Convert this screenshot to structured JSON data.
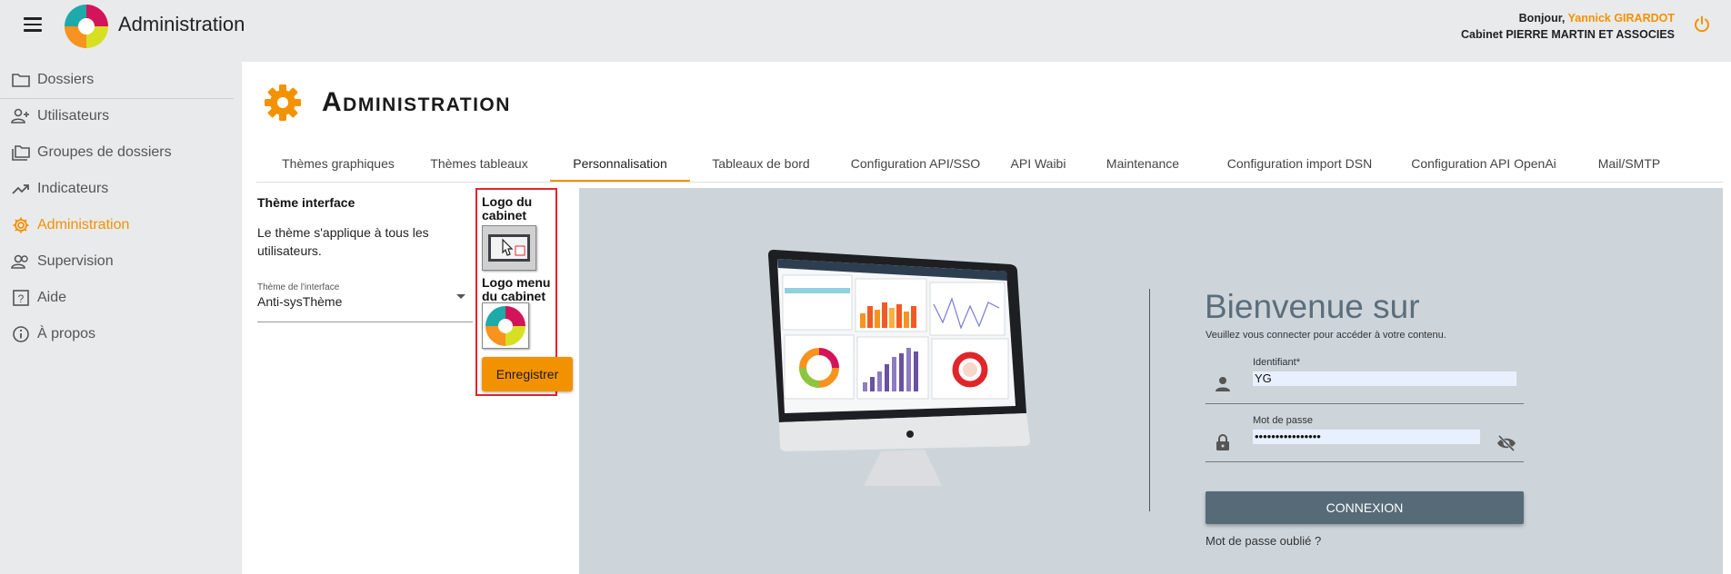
{
  "header": {
    "app_title": "Administration",
    "greeting_prefix": "Bonjour,",
    "user_name": "Yannick GIRARDOT",
    "company": "Cabinet PIERRE MARTIN ET ASSOCIES"
  },
  "sidebar": {
    "items": [
      {
        "label": "Dossiers",
        "icon": "folder-icon"
      },
      {
        "label": "Utilisateurs",
        "icon": "add-user-icon"
      },
      {
        "label": "Groupes de dossiers",
        "icon": "folders-icon"
      },
      {
        "label": "Indicateurs",
        "icon": "trend-icon"
      },
      {
        "label": "Administration",
        "icon": "gear-icon",
        "active": true
      },
      {
        "label": "Supervision",
        "icon": "users-icon"
      },
      {
        "label": "Aide",
        "icon": "help-icon"
      },
      {
        "label": "À propos",
        "icon": "info-icon"
      }
    ]
  },
  "page": {
    "title": "Administration",
    "tabs": [
      {
        "label": "Thèmes graphiques"
      },
      {
        "label": "Thèmes tableaux"
      },
      {
        "label": "Personnalisation",
        "active": true
      },
      {
        "label": "Tableaux de bord"
      },
      {
        "label": "Configuration API/SSO"
      },
      {
        "label": "API Waibi"
      },
      {
        "label": "Maintenance"
      },
      {
        "label": "Configuration import DSN"
      },
      {
        "label": "Configuration API OpenAi"
      },
      {
        "label": "Mail/SMTP"
      }
    ]
  },
  "theme": {
    "heading": "Thème interface",
    "description": "Le thème s'applique à tous les utilisateurs.",
    "select_label": "Thème de l'interface",
    "select_value": "Anti-sysThème"
  },
  "logos": {
    "cabinet_label": "Logo du cabinet",
    "menu_label": "Logo menu du cabinet",
    "save_label": "Enregistrer"
  },
  "preview": {
    "welcome_title": "Bienvenue sur",
    "welcome_subtitle": "Veuillez vous connecter pour accéder à votre contenu.",
    "login_label": "Identifiant*",
    "login_value": "YG",
    "password_label": "Mot de passe",
    "password_value": "••••••••••••••••",
    "connect_label": "CONNEXION",
    "forgot_label": "Mot de passe oublié ?"
  },
  "colors": {
    "accent": "#f39200",
    "highlight_border": "#e0262b",
    "login_button": "#566b77",
    "preview_background": "#cdd5db"
  }
}
